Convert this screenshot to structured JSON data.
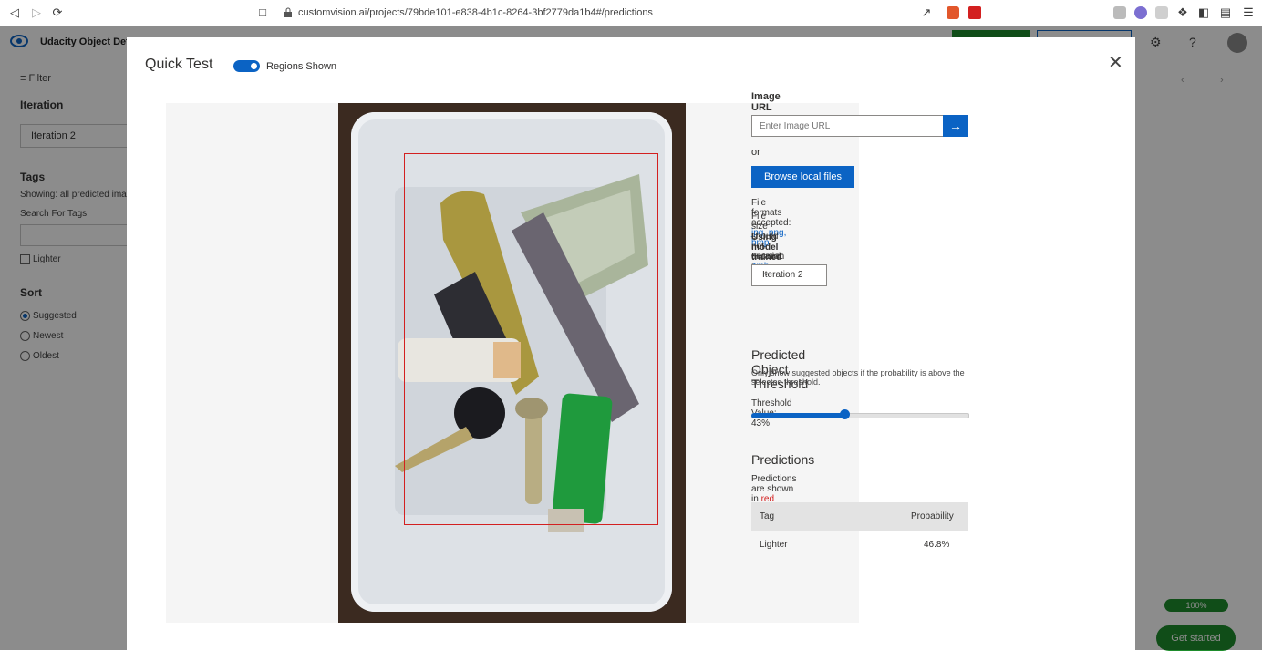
{
  "browser": {
    "url": "customvision.ai/projects/79bde101-e838-4b1c-8264-3bf2779da1b4#/predictions"
  },
  "app": {
    "title": "Udacity Object Detec"
  },
  "left_panel": {
    "filter_label": "Filter",
    "iteration_heading": "Iteration",
    "iteration_value": "Iteration 2",
    "tags_heading": "Tags",
    "showing_text": "Showing: all predicted ima",
    "search_label": "Search For Tags:",
    "tag_items": [
      {
        "label": "Lighter"
      }
    ],
    "sort_heading": "Sort",
    "sort_options": [
      {
        "label": "Suggested",
        "selected": true
      },
      {
        "label": "Newest",
        "selected": false
      },
      {
        "label": "Oldest",
        "selected": false
      }
    ]
  },
  "footer": {
    "progress_label": "100%",
    "get_started": "Get started"
  },
  "modal": {
    "title": "Quick Test",
    "regions_toggle_label": "Regions Shown",
    "regions_toggle_on": true,
    "image_url_heading": "Image URL",
    "image_url_placeholder": "Enter Image URL",
    "or_text": "or",
    "browse_button": "Browse local files",
    "formats_prefix": "File formats accepted: ",
    "formats_values": "jpg, png, bmp",
    "size_prefix": "File size should not exceed: ",
    "size_value": "4mb",
    "model_heading": "Using model trained in",
    "iteration_label": "Iteration",
    "iteration_value": "Iteration 2",
    "threshold_heading": "Predicted Object Threshold",
    "threshold_desc": "Only show suggested objects if the probability is above the selected threshold.",
    "threshold_value_label": "Threshold Value: 43%",
    "threshold_value": 0.43,
    "predictions_heading": "Predictions",
    "predictions_note_prefix": "Predictions are shown in ",
    "predictions_note_color": "red",
    "table": {
      "headers": [
        "Tag",
        "Probability"
      ],
      "rows": [
        {
          "tag": "Lighter",
          "probability": "46.8%"
        }
      ]
    }
  },
  "colors": {
    "accent": "#0b63c4",
    "green": "#1e8c2c",
    "prediction_box": "#d32020"
  }
}
